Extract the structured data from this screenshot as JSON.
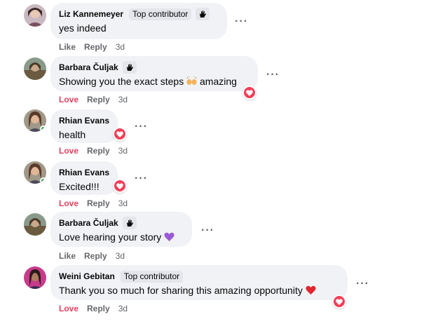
{
  "colors": {
    "bubble": "#f0f2f5",
    "love": "#e4405f",
    "meta": "#65676b",
    "online": "#31a24c"
  },
  "action_labels": {
    "like": "Like",
    "love": "Love",
    "reply": "Reply"
  },
  "comments": [
    {
      "author": "Liz Kannemeyer",
      "badge": "Top contributor",
      "has_badge_icon": true,
      "text": "yes indeed",
      "reaction_label": "Like",
      "time": "3d",
      "more": "···"
    },
    {
      "author": "Barbara Čuljak",
      "badge": "",
      "has_badge_icon": true,
      "text": "Showing you the exact steps",
      "emoji": "raising-hands",
      "text_after": "amazing",
      "reaction_label": "Love",
      "time": "3d",
      "more": "···",
      "reaction": "love"
    },
    {
      "author": "Rhian Evans",
      "badge": "",
      "text": "health",
      "reaction_label": "Love",
      "time": "3d",
      "more": "···",
      "reaction": "love",
      "online": true
    },
    {
      "author": "Rhian Evans",
      "badge": "",
      "text": "Excited!!!",
      "reaction_label": "Love",
      "time": "3d",
      "more": "···",
      "reaction": "love",
      "online": true
    },
    {
      "author": "Barbara Čuljak",
      "badge": "",
      "has_badge_icon": true,
      "text": "Love hearing your story",
      "emoji": "purple-heart",
      "reaction_label": "Like",
      "time": "3d",
      "more": "···"
    },
    {
      "author": "Weini Gebitan",
      "badge": "Top contributor",
      "text": "Thank you so much for sharing this amazing opportunity",
      "emoji": "red-heart",
      "reaction_label": "Love",
      "time": "3d",
      "more": "···",
      "reaction": "love"
    }
  ]
}
